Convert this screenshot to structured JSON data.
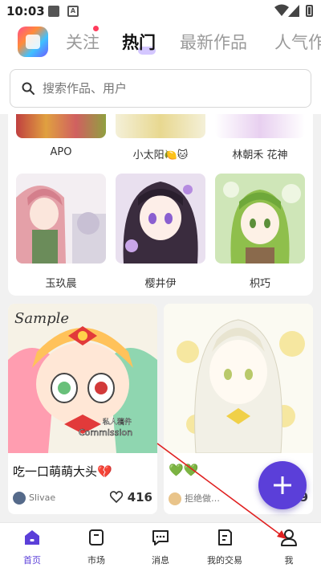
{
  "status": {
    "time": "10:03",
    "notif_badge": "A"
  },
  "header": {
    "tabs": [
      {
        "label": "关注",
        "has_dot": true
      },
      {
        "label": "热门",
        "active": true
      },
      {
        "label": "最新作品"
      },
      {
        "label": "人气作"
      }
    ]
  },
  "search": {
    "placeholder": "搜索作品、用户"
  },
  "authors_top": [
    "APO",
    "小太阳🍋🐱",
    "林朝禾 花神"
  ],
  "authors": [
    "玉玖晨",
    "樱井伊",
    "枳巧"
  ],
  "posts": [
    {
      "title": "吃一口萌萌大头💔",
      "user": "Slivae",
      "likes": "416",
      "art_text": [
        "Sample",
        "Commission",
        "私人稿件"
      ]
    },
    {
      "title": "💚💚",
      "user": "拒绝做…",
      "likes": "9"
    }
  ],
  "bottom_nav": [
    {
      "label": "首页",
      "icon": "home-icon",
      "active": true
    },
    {
      "label": "市场",
      "icon": "market-icon"
    },
    {
      "label": "消息",
      "icon": "message-icon"
    },
    {
      "label": "我的交易",
      "icon": "trade-icon"
    },
    {
      "label": "我",
      "icon": "profile-icon"
    }
  ],
  "colors": {
    "accent": "#5b3fd9",
    "dot": "#ff3b5c",
    "annotation_arrow": "#e02020"
  }
}
